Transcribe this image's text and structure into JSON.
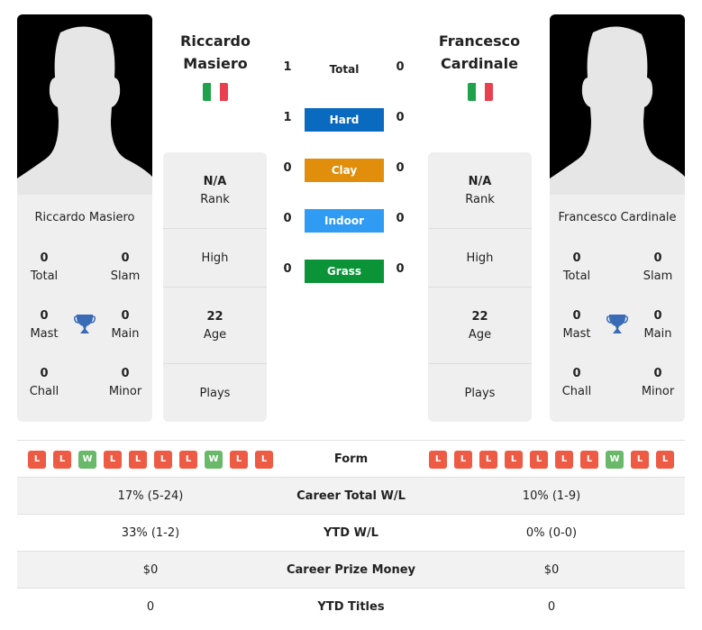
{
  "colors": {
    "hard": "#0a6abf",
    "clay": "#e08e0b",
    "indoor": "#2f9bf3",
    "grass": "#0b9338",
    "loss": "#ee5b44",
    "win": "#6ab96a",
    "trophy": "#3a6bb5",
    "flag_green": "#1fa34a",
    "flag_white": "#ffffff",
    "flag_red": "#e8404f"
  },
  "player1": {
    "name_line1": "Riccardo",
    "name_line2": "Masiero",
    "full_name": "Riccardo Masiero",
    "country_flag": "italy-flag",
    "titles": {
      "total": "0",
      "total_label": "Total",
      "slam": "0",
      "slam_label": "Slam",
      "mast": "0",
      "mast_label": "Mast",
      "main": "0",
      "main_label": "Main",
      "chall": "0",
      "chall_label": "Chall",
      "minor": "0",
      "minor_label": "Minor"
    },
    "rank_value": "N/A",
    "rank_label": "Rank",
    "high_label": "High",
    "age_value": "22",
    "age_label": "Age",
    "plays_label": "Plays",
    "form": [
      "L",
      "L",
      "W",
      "L",
      "L",
      "L",
      "L",
      "W",
      "L",
      "L"
    ]
  },
  "player2": {
    "name_line1": "Francesco",
    "name_line2": "Cardinale",
    "full_name": "Francesco Cardinale",
    "country_flag": "italy-flag",
    "titles": {
      "total": "0",
      "total_label": "Total",
      "slam": "0",
      "slam_label": "Slam",
      "mast": "0",
      "mast_label": "Mast",
      "main": "0",
      "main_label": "Main",
      "chall": "0",
      "chall_label": "Chall",
      "minor": "0",
      "minor_label": "Minor"
    },
    "rank_value": "N/A",
    "rank_label": "Rank",
    "high_label": "High",
    "age_value": "22",
    "age_label": "Age",
    "plays_label": "Plays",
    "form": [
      "L",
      "L",
      "L",
      "L",
      "L",
      "L",
      "L",
      "W",
      "L",
      "L"
    ]
  },
  "h2h": [
    {
      "label": "Total",
      "p1": "1",
      "p2": "0"
    },
    {
      "label": "Hard",
      "p1": "1",
      "p2": "0"
    },
    {
      "label": "Clay",
      "p1": "0",
      "p2": "0"
    },
    {
      "label": "Indoor",
      "p1": "0",
      "p2": "0"
    },
    {
      "label": "Grass",
      "p1": "0",
      "p2": "0"
    }
  ],
  "comparison": {
    "form_label": "Form",
    "rows": [
      {
        "label": "Career Total W/L",
        "p1": "17% (5-24)",
        "p2": "10% (1-9)"
      },
      {
        "label": "YTD W/L",
        "p1": "33% (1-2)",
        "p2": "0% (0-0)"
      },
      {
        "label": "Career Prize Money",
        "p1": "$0",
        "p2": "$0"
      },
      {
        "label": "YTD Titles",
        "p1": "0",
        "p2": "0"
      }
    ]
  }
}
